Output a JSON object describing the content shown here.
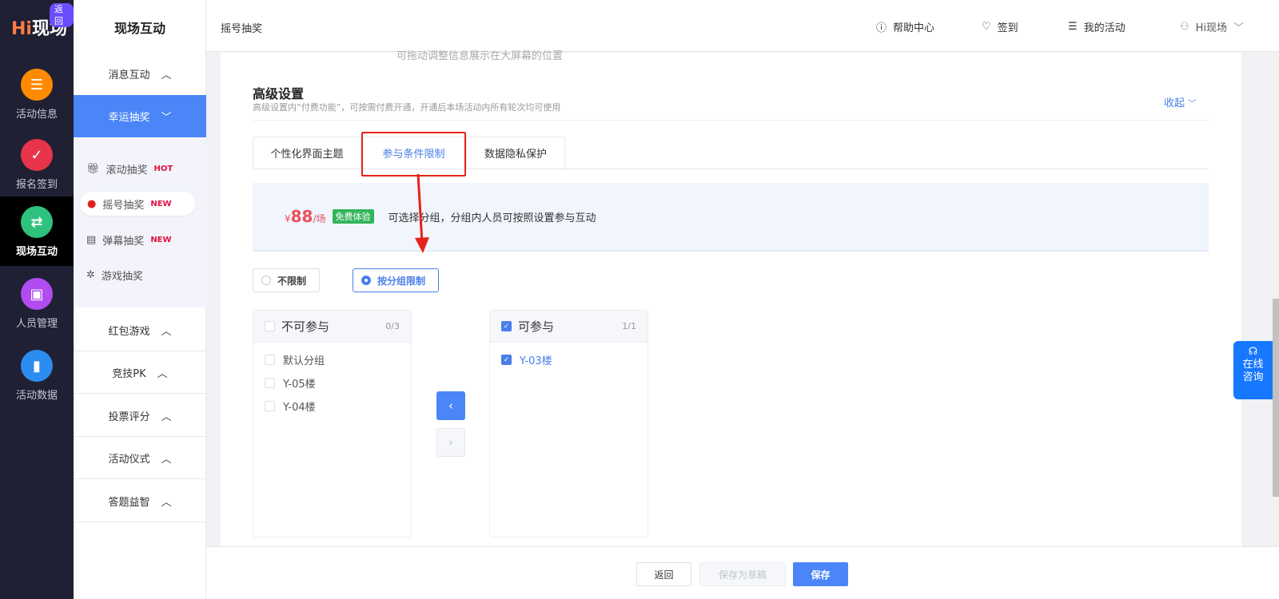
{
  "nav": {
    "logo": "Hi现场",
    "logo_hi": "Hi",
    "logo_rest": "现场",
    "back": "返回",
    "items": [
      {
        "label": "活动信息",
        "color": "#ff8a00",
        "icon": "document-icon"
      },
      {
        "label": "报名签到",
        "color": "#e8344b",
        "icon": "calendar-check-icon"
      },
      {
        "label": "现场互动",
        "color": "#2ec27e",
        "icon": "swap-icon",
        "active": true
      },
      {
        "label": "人员管理",
        "color": "#b04cf0",
        "icon": "person-card-icon"
      },
      {
        "label": "活动数据",
        "color": "#2d8cf0",
        "icon": "bar-chart-icon"
      }
    ]
  },
  "sidebar": {
    "title": "现场互动",
    "groups": [
      {
        "label": "消息互动"
      },
      {
        "label": "幸运抽奖"
      },
      {
        "label": "红包游戏"
      },
      {
        "label": "竞技PK"
      },
      {
        "label": "投票评分"
      },
      {
        "label": "活动仪式"
      },
      {
        "label": "答题益智"
      }
    ],
    "subitems": [
      {
        "label": "滚动抽奖",
        "badge": "HOT",
        "icon": "gift-icon"
      },
      {
        "label": "摇号抽奖",
        "badge": "NEW",
        "icon": "person-icon"
      },
      {
        "label": "弹幕抽奖",
        "badge": "NEW",
        "icon": "barrage-icon"
      },
      {
        "label": "游戏抽奖",
        "badge": "",
        "icon": "wheel-icon"
      }
    ]
  },
  "header": {
    "title": "摇号抽奖",
    "help": "帮助中心",
    "checkin": "签到",
    "my_activities": "我的活动",
    "user": "Hi现场"
  },
  "content": {
    "clipped_hint": "可拖动调整信息展示在大屏幕的位置",
    "section_title": "高级设置",
    "section_desc": "高级设置内“付费功能”，可按需付费开通，开通后本场活动内所有轮次均可使用",
    "collapse": "收起",
    "tabs": [
      "个性化界面主题",
      "参与条件限制",
      "数据隐私保护"
    ],
    "active_tab": 1,
    "info": {
      "currency": "¥",
      "price": "88",
      "unit": "/场",
      "free_badge": "免费体验",
      "desc": "可选择分组，分组内人员可按照设置参与互动"
    },
    "radios": [
      {
        "label": "不限制",
        "checked": false
      },
      {
        "label": "按分组限制",
        "checked": true
      }
    ],
    "transfer": {
      "left": {
        "title": "不可参与",
        "count": "0/3",
        "items": [
          "默认分组",
          "Y-05楼",
          "Y-04楼"
        ]
      },
      "right": {
        "title": "可参与",
        "count": "1/1",
        "items": [
          "Y-03楼"
        ]
      }
    }
  },
  "footer": {
    "back": "返回",
    "draft": "保存为草稿",
    "save": "保存"
  },
  "chat": {
    "line1": "在线",
    "line2": "咨询"
  },
  "colors": {
    "primary": "#4a86f7",
    "annotation": "#e5231b",
    "price": "#e8505b",
    "free": "#33b55b"
  }
}
